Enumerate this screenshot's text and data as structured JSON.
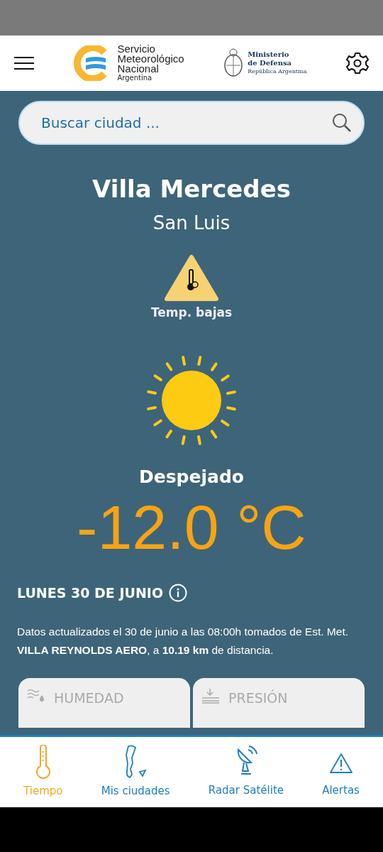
{
  "header": {
    "logo_lines": [
      "Servicio",
      "Meteorológico",
      "Nacional"
    ],
    "logo_sub": "Argentina",
    "ministry_lines": [
      "Ministerio",
      "de Defensa"
    ],
    "ministry_sub": "República Argentina"
  },
  "search": {
    "placeholder": "Buscar ciudad ..."
  },
  "location": {
    "city": "Villa Mercedes",
    "province": "San Luis"
  },
  "alert": {
    "label": "Temp. bajas"
  },
  "condition": "Despejado",
  "temperature": "-12.0 °C",
  "date": "LUNES 30 DE JUNIO",
  "note": "Datos actualizados el 30 de junio a las 08:00h tomados de Est. Met. **VILLA REYNOLDS AERO**, a **10.19 km** de distancia.",
  "cards": [
    {
      "kind": "humidity",
      "label": "HUMEDAD"
    },
    {
      "kind": "pressure",
      "label": "PRESIÓN"
    }
  ],
  "nav": [
    {
      "kind": "weather",
      "label": "Tiempo",
      "selected": true
    },
    {
      "kind": "cities",
      "label": "Mis ciudades",
      "selected": false
    },
    {
      "kind": "radar",
      "label": "Radar Satélite",
      "selected": false
    },
    {
      "kind": "alerts",
      "label": "Alertas",
      "selected": false
    }
  ]
}
